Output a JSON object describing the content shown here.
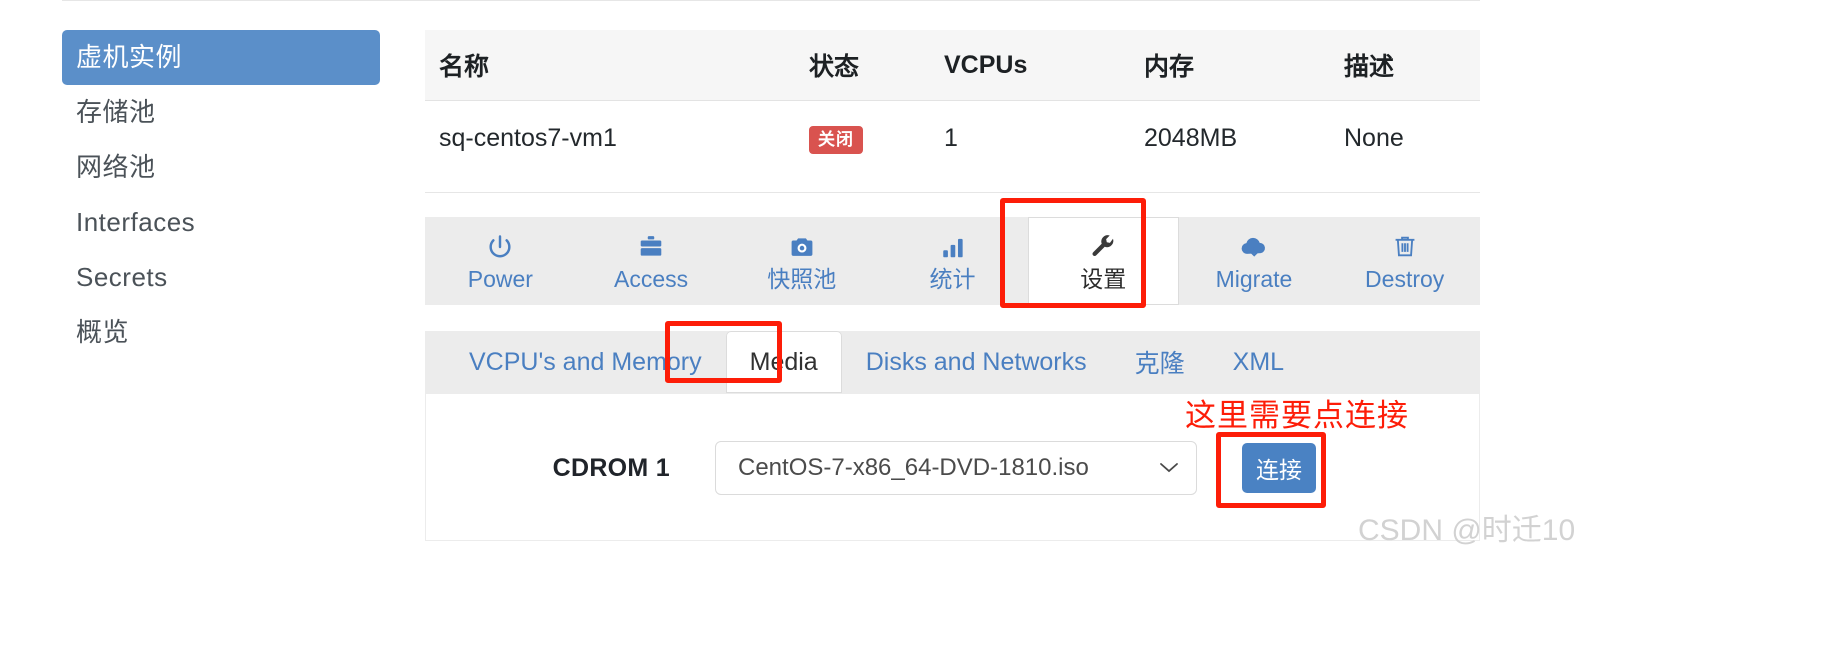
{
  "sidebar": {
    "items": [
      {
        "label": "虚机实例",
        "active": true
      },
      {
        "label": "存储池",
        "active": false
      },
      {
        "label": "网络池",
        "active": false
      },
      {
        "label": "Interfaces",
        "active": false
      },
      {
        "label": "Secrets",
        "active": false
      },
      {
        "label": "概览",
        "active": false
      }
    ]
  },
  "vm_table": {
    "headers": [
      "名称",
      "状态",
      "VCPUs",
      "内存",
      "描述"
    ],
    "rows": [
      {
        "name": "sq-centos7-vm1",
        "state": "关闭",
        "vcpus": "1",
        "memory": "2048MB",
        "description": "None"
      }
    ]
  },
  "toolbar": {
    "items": [
      {
        "label": "Power",
        "icon": "power-icon",
        "active": false
      },
      {
        "label": "Access",
        "icon": "briefcase-icon",
        "active": false
      },
      {
        "label": "快照池",
        "icon": "camera-icon",
        "active": false
      },
      {
        "label": "统计",
        "icon": "bar-chart-icon",
        "active": false
      },
      {
        "label": "设置",
        "icon": "wrench-icon",
        "active": true
      },
      {
        "label": "Migrate",
        "icon": "cloud-download-icon",
        "active": false
      },
      {
        "label": "Destroy",
        "icon": "trash-icon",
        "active": false
      }
    ]
  },
  "settings_tabs": [
    {
      "label": "VCPU's and Memory",
      "active": false
    },
    {
      "label": "Media",
      "active": true
    },
    {
      "label": "Disks and Networks",
      "active": false
    },
    {
      "label": "克隆",
      "active": false
    },
    {
      "label": "XML",
      "active": false
    }
  ],
  "media": {
    "cdrom_label": "CDROM 1",
    "iso_value": "CentOS-7-x86_64-DVD-1810.iso",
    "connect_button": "连接"
  },
  "annotations": {
    "note_text": "这里需要点连接",
    "note_color": "#fd1d08"
  },
  "watermark": "CSDN @时迁10",
  "colors": {
    "sidebar_active_bg": "#5b8fc9",
    "link_blue": "#4a7fc1",
    "badge_red": "#d9534f",
    "annotation_red": "#fd1d08",
    "toolbar_bg": "#ececec",
    "button_blue": "#4a82c3"
  }
}
